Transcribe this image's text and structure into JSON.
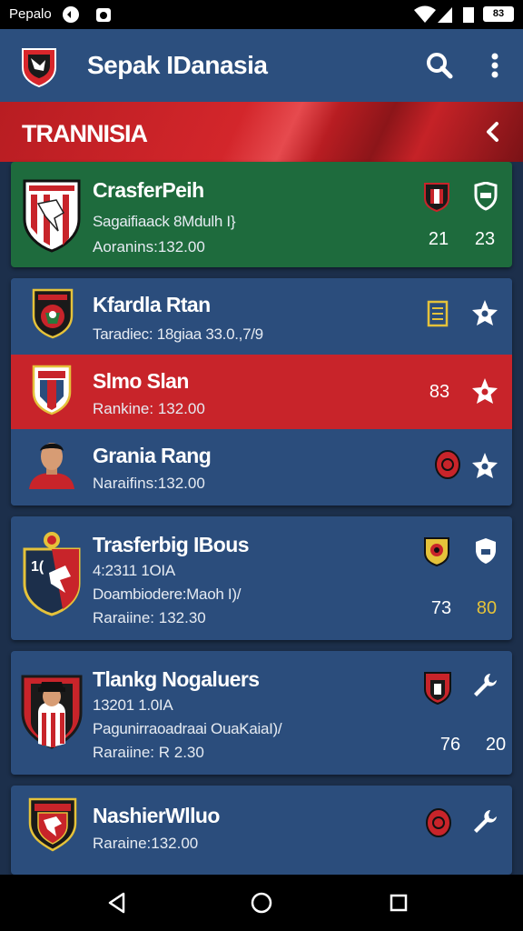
{
  "status_bar": {
    "carrier": "Pepalo",
    "battery": "83"
  },
  "app_bar": {
    "title": "Sepak IDanasia"
  },
  "banner": {
    "title": "TRANNISIA"
  },
  "cards": [
    {
      "title": "CrasferPeih",
      "subtitle": "Sagaifiaack 8Mdulh I}",
      "ranking": "Aoranins:132.00",
      "num1": "21",
      "num2": "23",
      "color": "#1e6b3d"
    },
    {
      "title": "Kfardla Rtan",
      "subtitle": "Taradiec: 18giaa 33.0.,7/9",
      "color": "#2b4d7c"
    },
    {
      "title": "Slmo Slan",
      "ranking": "Rankine: 132.00",
      "num1": "83",
      "color": "#c8242a"
    },
    {
      "title": "Grania Rang",
      "ranking": "Naraifins:132.00",
      "color": "#2b4d7c"
    },
    {
      "title": "Trasferbig IBous",
      "subtitle": "4:2311 1OIA",
      "subtitle2": "Doambiodere:Maoh I)/",
      "ranking": "Raraiine: 132.30",
      "num1": "73",
      "num2": "80",
      "color": "#2b4d7c"
    },
    {
      "title": "Tlankg Nogaluers",
      "subtitle": "13201 1.0IA",
      "subtitle2": "Pagunirraoadraai OuaKaiaI)/",
      "ranking": "Raraiine: R 2.30",
      "num1": "76",
      "num2": "20",
      "color": "#2b4d7c"
    },
    {
      "title": "NashierWlluo",
      "ranking": "Raraine:132.00",
      "color": "#2b4d7c"
    }
  ],
  "colors": {
    "accent_red": "#c8242a",
    "green": "#1e6b3d",
    "card_blue": "#2b4d7c",
    "gold": "#e5c23a"
  },
  "icons": [
    "search-icon",
    "overflow-menu-icon",
    "back-chevron-icon",
    "star-icon",
    "shield-icon",
    "wrench-icon",
    "target-icon",
    "notes-icon"
  ]
}
